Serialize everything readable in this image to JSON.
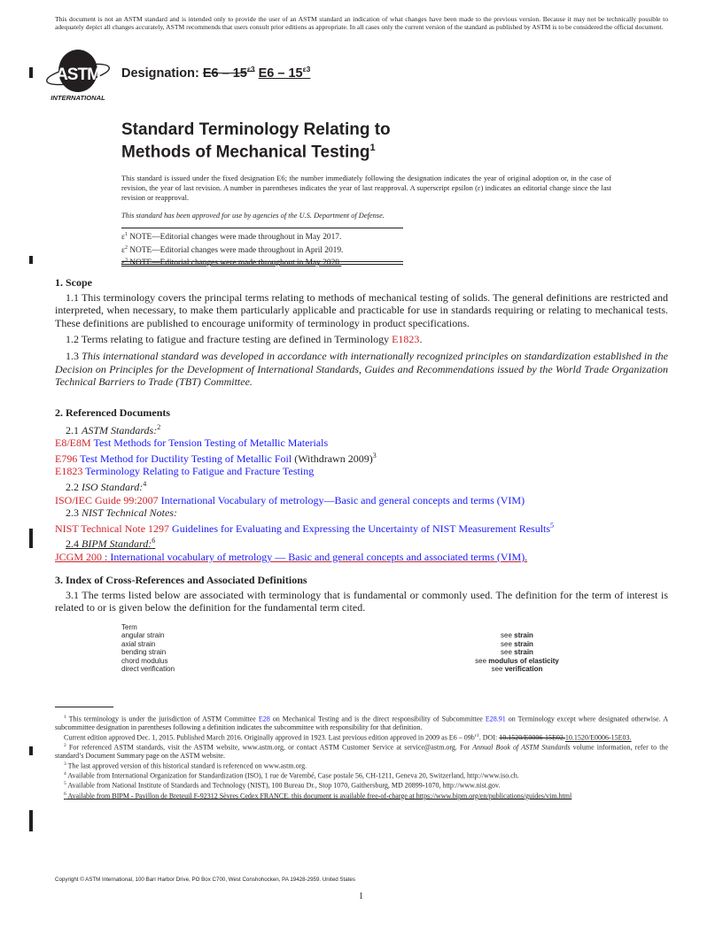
{
  "disclaimer": "This document is not an ASTM standard and is intended only to provide the user of an ASTM standard an indication of what changes have been made to the previous version. Because it may not be technically possible to adequately depict all changes accurately, ASTM recommends that users consult prior editions as appropriate. In all cases only the current version of the standard as published by ASTM is to be considered the official document.",
  "logo": {
    "letters": "ASTM",
    "subtitle": "INTERNATIONAL"
  },
  "designation": {
    "label": "Designation:",
    "old": "E6 – 15",
    "old_sup": "ε3",
    "new": "E6 – 15",
    "new_sup": "ε3"
  },
  "title": {
    "line1": "Standard Terminology Relating to",
    "line2": "Methods of Mechanical Testing",
    "footnote_ref": "1"
  },
  "issue_statement": "This standard is issued under the fixed designation E6; the number immediately following the designation indicates the year of original adoption or, in the case of revision, the year of last revision. A number in parentheses indicates the year of last reapproval. A superscript epsilon (ε) indicates an editorial change since the last revision or reapproval.",
  "dod_statement": "This standard has been approved for use by agencies of the U.S. Department of Defense.",
  "editorial_notes": [
    {
      "sup": "1",
      "text": "NOTE—Editorial changes were made throughout in May 2017."
    },
    {
      "sup": "2",
      "text": "NOTE—Editorial changes were made throughout in April 2019."
    },
    {
      "sup": "3",
      "text": "NOTE—Editorial changes were made throughout in May 2020."
    }
  ],
  "sections": {
    "scope": {
      "heading": "1. Scope",
      "p1_1": "1.1 This terminology covers the principal terms relating to methods of mechanical testing of solids. The general definitions are restricted and interpreted, when necessary, to make them particularly applicable and practicable for use in standards requiring or relating to mechanical tests. These definitions are published to encourage uniformity of terminology in product specifications.",
      "p1_2_text": "1.2 Terms relating to fatigue and fracture testing are defined in Terminology ",
      "p1_2_link": "E1823",
      "p1_3_num": "1.3 ",
      "p1_3_text": "This international standard was developed in accordance with internationally recognized principles on standardization established in the Decision on Principles for the Development of International Standards, Guides and Recommendations issued by the World Trade Organization Technical Barriers to Trade (TBT) Committee."
    },
    "referenced": {
      "heading": "2. Referenced Documents",
      "astm_num": "2.1 ",
      "astm_label": "ASTM Standards:",
      "astm_sup": "2",
      "astm_refs": [
        {
          "code": "E8/E8M",
          "title": "Test Methods for Tension Testing of Metallic Materials",
          "extra": "",
          "sup": ""
        },
        {
          "code": "E796",
          "title": "Test Method for Ductility Testing of Metallic Foil",
          "extra": " (Withdrawn 2009)",
          "sup": "3"
        },
        {
          "code": "E1823",
          "title": "Terminology Relating to Fatigue and Fracture Testing",
          "extra": "",
          "sup": ""
        }
      ],
      "iso_num": "2.2 ",
      "iso_label": "ISO Standard:",
      "iso_sup": "4",
      "iso_ref": {
        "code": "ISO/IEC Guide 99:2007",
        "title": "International Vocabulary of metrology—Basic and general concepts and terms (VIM)"
      },
      "nist_num": "2.3 ",
      "nist_label": "NIST Technical Notes:",
      "nist_ref": {
        "code": "NIST Technical Note 1297",
        "title": "Guidelines for Evaluating and Expressing the Uncertainty of NIST Measurement Results",
        "sup": "5"
      },
      "bipm_num": "2.4 ",
      "bipm_label": "BIPM Standard:",
      "bipm_sup": "6",
      "bipm_ref": {
        "code": "JCGM 200",
        "title": " : International vocabulary of metrology — Basic and general concepts and associated terms (VIM)."
      }
    },
    "index": {
      "heading": "3. Index of Cross-References and Associated Definitions",
      "p3_1": "3.1 The terms listed below are associated with terminology that is fundamental or commonly used. The definition for the term of interest is related to or is given below the definition for the fundamental term cited.",
      "table_header": "Term",
      "rows": [
        {
          "term": "angular strain",
          "see": "see ",
          "target": "strain"
        },
        {
          "term": "axial strain",
          "see": "see ",
          "target": "strain"
        },
        {
          "term": "bending strain",
          "see": "see ",
          "target": "strain"
        },
        {
          "term": "chord modulus",
          "see": "see ",
          "target": "modulus of elasticity"
        },
        {
          "term": "direct verification",
          "see": "see ",
          "target": "verification"
        }
      ]
    }
  },
  "footnotes": {
    "fn1_sup": "1",
    "fn1_a": "This terminology is under the jurisdiction of ASTM Committee ",
    "fn1_link1": "E28",
    "fn1_b": " on Mechanical Testing and is the direct responsibility of Subcommittee ",
    "fn1_link2": "E28.91",
    "fn1_c": " on Terminology except where designated otherwise. A subcommittee designation in parentheses following a definition indicates the subcommittee with responsibility for that definition.",
    "fn1_edition": "Current edition approved Dec. 1, 2015. Published March 2016. Originally approved in 1923. Last previous edition approved in 2009 as E6 – 09b",
    "fn1_edition_sup": "ε1",
    "fn1_doi_label": ". DOI: ",
    "fn1_doi_old": "10.1520/E0006-15E02.",
    "fn1_doi_new": "10.1520/E0006-15E03.",
    "fn2_sup": "2",
    "fn2_a": "For referenced ASTM standards, visit the ASTM website, www.astm.org, or contact ASTM Customer Service at service@astm.org. For ",
    "fn2_italic": "Annual Book of ASTM Standards",
    "fn2_b": " volume information, refer to the standard’s Document Summary page on the ASTM website.",
    "fn3_sup": "3",
    "fn3": "The last approved version of this historical standard is referenced on www.astm.org.",
    "fn4_sup": "4",
    "fn4": "Available from International Organization for Standardization (ISO), 1 rue de Varembé, Case postale 56, CH-1211, Geneva 20, Switzerland, http://www.iso.ch.",
    "fn5_sup": "5",
    "fn5": "Available from National Institute of Standards and Technology (NIST), 100 Bureau Dr., Stop 1070, Gaithersburg, MD 20899-1070, http://www.nist.gov.",
    "fn6_sup": "6",
    "fn6": "Available from BIPM - Pavillon de Breteuil F-92312 Sèvres Cedex FRANCE. this document is available free-of-charge at https://www.bipm.org/en/publications/guides/vim.html"
  },
  "copyright": "Copyright © ASTM International, 100 Barr Harbor Drive, PO Box C700, West Conshohocken, PA 19428-2959. United States",
  "page_number": "1",
  "colors": {
    "link_code": "#d2232a",
    "link_title": "#1a1aff",
    "text": "#231f20"
  }
}
